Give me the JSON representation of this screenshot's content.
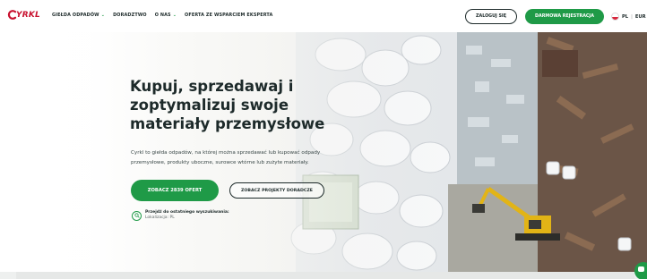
{
  "brand": {
    "logo_text": "YRKL",
    "color": "#c8102e"
  },
  "nav": {
    "items": [
      {
        "label": "GIEŁDA ODPADÓW",
        "dropdown": true
      },
      {
        "label": "DORADZTWO",
        "dropdown": false
      },
      {
        "label": "O NAS",
        "dropdown": true
      },
      {
        "label": "OFERTA ZE WSPARCIEM EKSPERTA",
        "dropdown": false
      }
    ]
  },
  "header": {
    "login_label": "ZALOGUJ SIĘ",
    "register_label": "DARMOWA REJESTRACJA",
    "language": "PL",
    "separator": "|",
    "currency": "EUR"
  },
  "hero": {
    "headline": "Kupuj, sprzedawaj i zoptymalizuj swoje materiały przemysłowe",
    "subtitle": "Cyrkl to giełda odpadów, na której można sprzedawać lub kupować odpady przemysłowe, produkty uboczne, surowce wtórne lub zużyte materiały.",
    "primary_button": "ZOBACZ 2839 OFERT",
    "secondary_button": "ZOBACZ PROJEKTY DORADCZE",
    "last_search_title": "Przejdź do ostatniego wyszukiwania:",
    "last_search_location": "Lokalizacja: PL"
  },
  "colors": {
    "accent": "#1f9a47",
    "text_dark": "#1d2a2a"
  },
  "icons": [
    "chevron-down-icon",
    "search-icon",
    "poland-flag-icon",
    "chat-icon"
  ]
}
